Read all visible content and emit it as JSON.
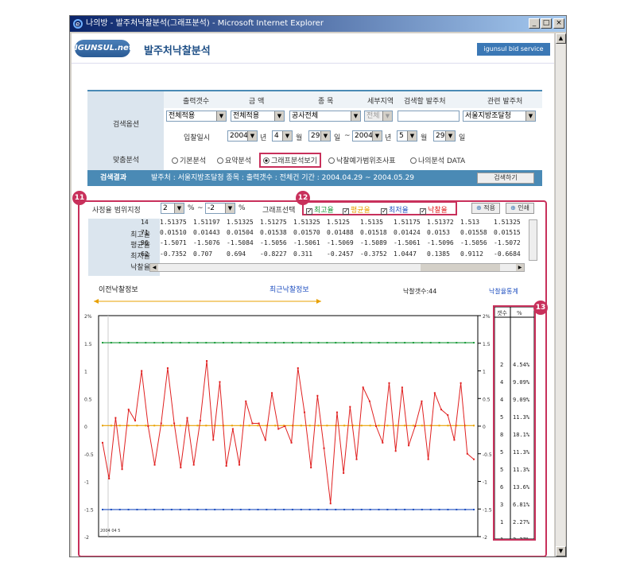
{
  "window": {
    "title": "나의방 - 발주처낙찰분석(그래프분석) - Microsoft Internet Explorer",
    "min": "_",
    "max": "□",
    "close": "×"
  },
  "header": {
    "logo": "IGUNSUL.net",
    "page_title": "발주처낙찰분석",
    "service": "igunsul bid service"
  },
  "search": {
    "section_label": "검색옵션",
    "cols": [
      "출력갯수",
      "금 액",
      "종 목",
      "세부지역",
      "검색할 발주처",
      "관련 발주처"
    ],
    "values": [
      "전체적용",
      "전체적용",
      "공사전체",
      "전체",
      "",
      "서울지방조달청"
    ],
    "date_label": "입찰일시",
    "date_from": [
      "2004",
      "4",
      "29"
    ],
    "date_to": [
      "2004",
      "5",
      "29"
    ],
    "unit_year": "년",
    "unit_month": "월",
    "unit_day": "일",
    "tilde": "~",
    "analysis_label": "맞춤분석",
    "radios": [
      "기본분석",
      "요약분석",
      "그래프분석보기",
      "낙찰예가범위조사표",
      "나의분석 DATA"
    ],
    "radio_selected": 2
  },
  "result": {
    "label": "검색결과",
    "summary": "발주처 : 서울지방조달청   종목 :   출력갯수 : 전체건   기간 : 2004.04.29 ~ 2004.05.29",
    "button": "검색하기"
  },
  "range": {
    "label": "사정율 범위지정",
    "from": "2",
    "to": "-2",
    "pct": "%",
    "tilde": "~",
    "graph_select": "그래프선택",
    "checks": [
      "최고율",
      "평균율",
      "최저율",
      "낙찰율"
    ],
    "check_colors": [
      "#1a9a3a",
      "#e8a000",
      "#2050c0",
      "#e02020"
    ],
    "apply": "적용",
    "print": "인쇄"
  },
  "badges": [
    "11",
    "12",
    "13"
  ],
  "stats": {
    "labels": [
      "최고율",
      "평균율",
      "최저율",
      "낙찰율"
    ],
    "rows": [
      [
        "14",
        "1.51375",
        "1.51197",
        "1.51325",
        "1.51275",
        "1.51325",
        "1.5125",
        "1.5135",
        "1.51175",
        "1.51372",
        "1.513",
        "1.51325"
      ],
      [
        "71",
        "0.01510",
        "0.01443",
        "0.01504",
        "0.01538",
        "0.01570",
        "0.01488",
        "0.01518",
        "0.01424",
        "0.0153",
        "0.01558",
        "0.01515"
      ],
      [
        "96",
        "-1.5071",
        "-1.5076",
        "-1.5084",
        "-1.5056",
        "-1.5061",
        "-1.5069",
        "-1.5089",
        "-1.5061",
        "-1.5096",
        "-1.5056",
        "-1.5072"
      ],
      [
        "62",
        "-0.7352",
        "0.707",
        "0.694",
        "-0.8227",
        "0.311",
        "-0.2457",
        "-0.3752",
        "1.0447",
        "0.1385",
        "0.9112",
        "-0.6684"
      ]
    ]
  },
  "chart_labels": {
    "prev": "이전낙찰정보",
    "recent": "최근낙찰정보",
    "count": "낙찰갯수:44",
    "dist_title": "낙찰율통계",
    "dist_cols": [
      "갯수",
      "%"
    ],
    "start_date": "2004 04 5"
  },
  "chart_data": {
    "type": "line",
    "ylim": [
      -2,
      2
    ],
    "yticks": [
      "2%",
      "1.5",
      "1",
      "0.5",
      "0",
      "-0.5",
      "-1",
      "-1.5",
      "-2"
    ],
    "series": [
      {
        "color": "#1a9a3a",
        "values": [
          1.51,
          1.51,
          1.51,
          1.51,
          1.51,
          1.51,
          1.51,
          1.51,
          1.51,
          1.51,
          1.51,
          1.51,
          1.51,
          1.51,
          1.51,
          1.51,
          1.51,
          1.51,
          1.51,
          1.51,
          1.51,
          1.51,
          1.51,
          1.51,
          1.51,
          1.51,
          1.51,
          1.51,
          1.51,
          1.51,
          1.51,
          1.51,
          1.51,
          1.51,
          1.51,
          1.51,
          1.51,
          1.51,
          1.51,
          1.51,
          1.51,
          1.51,
          1.51,
          1.51
        ]
      },
      {
        "color": "#e8a000",
        "values": [
          0.01,
          0.01,
          0.01,
          0.01,
          0.01,
          0.01,
          0.01,
          0.01,
          0.01,
          0.01,
          0.01,
          0.01,
          0.01,
          0.01,
          0.01,
          0.01,
          0.01,
          0.01,
          0.01,
          0.01,
          0.01,
          0.01,
          0.01,
          0.01,
          0.01,
          0.01,
          0.01,
          0.01,
          0.01,
          0.01,
          0.01,
          0.01,
          0.01,
          0.01,
          0.01,
          0.01,
          0.01,
          0.01,
          0.01,
          0.01,
          0.01,
          0.01,
          0.01,
          0.01
        ]
      },
      {
        "color": "#2050c0",
        "values": [
          -1.51,
          -1.51,
          -1.51,
          -1.51,
          -1.51,
          -1.51,
          -1.51,
          -1.51,
          -1.51,
          -1.51,
          -1.51,
          -1.51,
          -1.51,
          -1.51,
          -1.51,
          -1.51,
          -1.51,
          -1.51,
          -1.51,
          -1.51,
          -1.51,
          -1.51,
          -1.51,
          -1.51,
          -1.51,
          -1.51,
          -1.51,
          -1.51,
          -1.51,
          -1.51,
          -1.51,
          -1.51,
          -1.51,
          -1.51,
          -1.51,
          -1.51,
          -1.51,
          -1.51,
          -1.51,
          -1.51,
          -1.51,
          -1.51,
          -1.51,
          -1.51
        ]
      },
      {
        "color": "#e02020",
        "values": [
          -0.3,
          -0.95,
          0.15,
          -0.78,
          0.3,
          0.1,
          1.0,
          0.0,
          -0.7,
          0.05,
          1.05,
          0.05,
          -0.75,
          0.15,
          -0.7,
          0.1,
          1.18,
          -0.25,
          0.8,
          -0.72,
          -0.05,
          -0.7,
          0.45,
          0.05,
          0.05,
          -0.25,
          0.6,
          -0.05,
          0.0,
          -0.3,
          1.05,
          0.25,
          -0.75,
          0.55,
          -0.4,
          -1.4,
          0.25,
          -0.85,
          0.35,
          -0.6,
          0.7,
          0.45,
          0.0,
          -0.3,
          0.78,
          -0.45,
          0.7,
          -0.35,
          0.0,
          0.45,
          -0.6,
          0.6,
          0.3,
          0.2,
          -0.25,
          0.78,
          -0.5,
          -0.6
        ]
      }
    ],
    "dist": [
      [
        "2",
        "4.54%"
      ],
      [
        "4",
        "9.09%"
      ],
      [
        "4",
        "9.09%"
      ],
      [
        "5",
        "11.3%"
      ],
      [
        "8",
        "18.1%"
      ],
      [
        "5",
        "11.3%"
      ],
      [
        "5",
        "11.3%"
      ],
      [
        "6",
        "13.6%"
      ],
      [
        "3",
        "6.81%"
      ],
      [
        "1",
        "2.27%"
      ],
      [
        "1",
        "2.27%"
      ]
    ]
  }
}
